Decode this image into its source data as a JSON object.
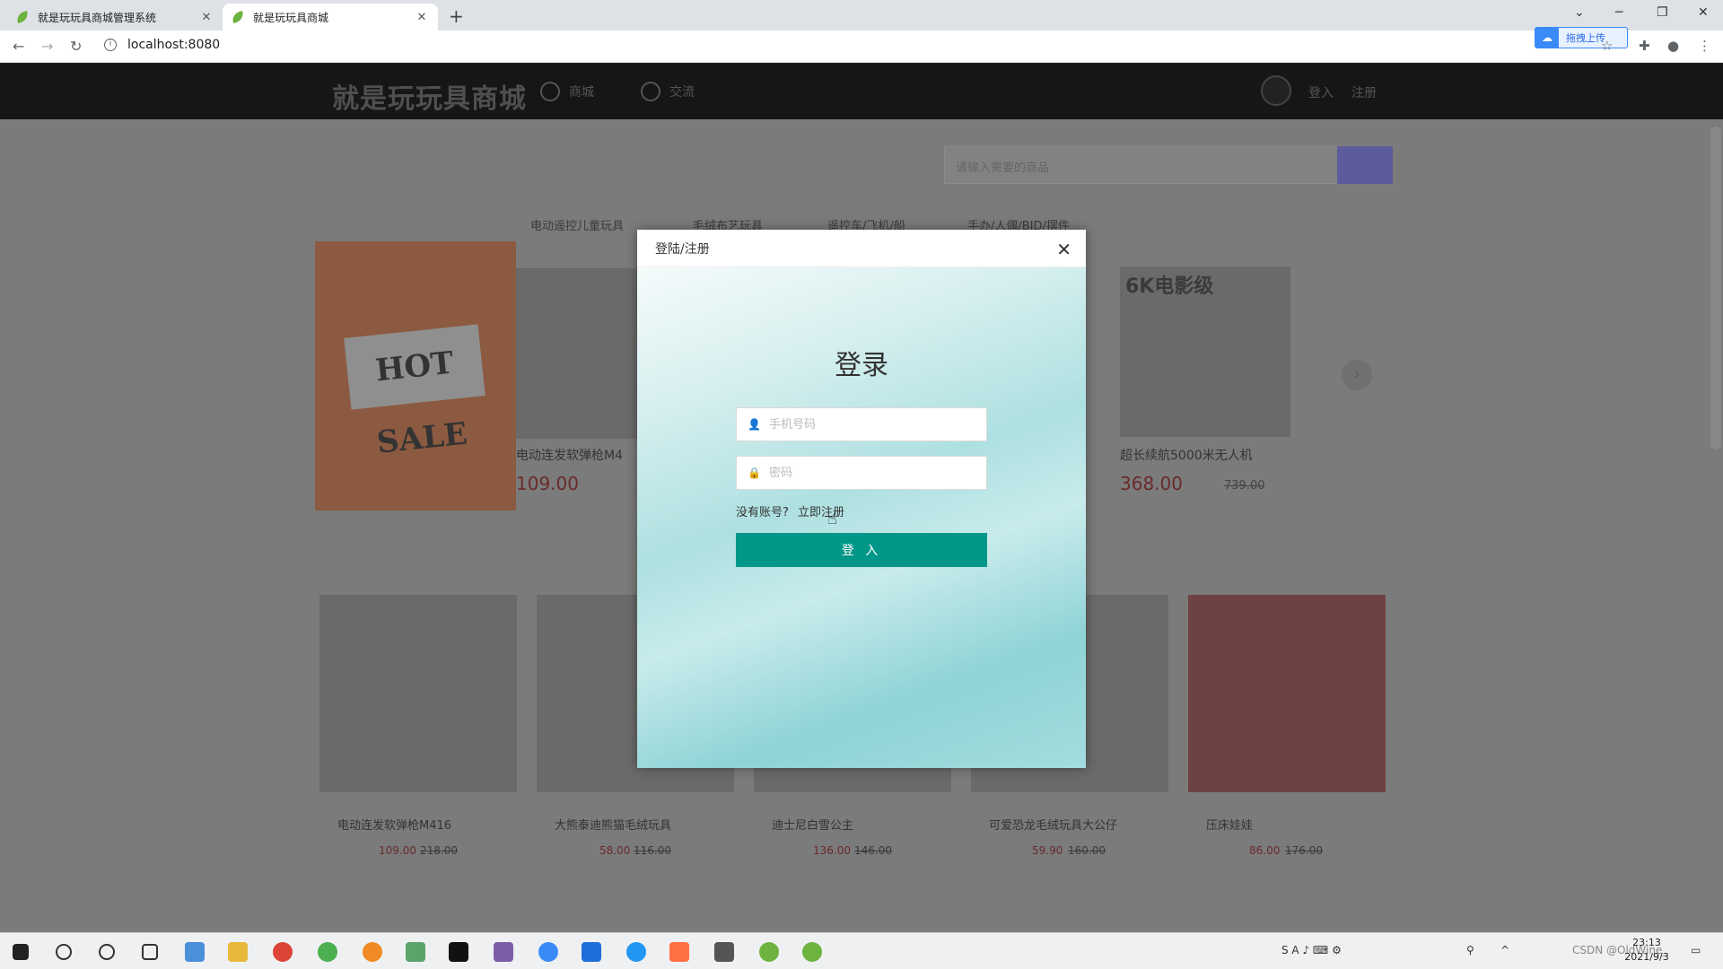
{
  "browser": {
    "tabs": [
      {
        "title": "就是玩玩具商城管理系统",
        "active": false
      },
      {
        "title": "就是玩玩具商城",
        "active": true
      }
    ],
    "url": "localhost:8080",
    "upload_label": "拖拽上传"
  },
  "site": {
    "logo": "就是玩玩具商城",
    "nav": [
      "商城",
      "交流"
    ],
    "login_link": "登入",
    "register_link": "注册",
    "search_placeholder": "请输入需要的商品",
    "categories": [
      "电动遥控儿童玩具",
      "毛绒布艺玩具",
      "遥控车/飞机/船",
      "手办/人偶/BJD/摆件"
    ],
    "hot_sale": "HOT SALE",
    "featured": [
      {
        "title": "电动连发软弹枪M4",
        "price": "109.00"
      },
      {
        "title": "超长续航5000米无人机",
        "price": "368.00",
        "old_price": "739.00"
      }
    ],
    "drone_banner": "6K电影级",
    "cards": [
      {
        "title": "电动连发软弹枪M416",
        "price": "109.00",
        "old_price": "218.00"
      },
      {
        "title": "大熊泰迪熊猫毛绒玩具",
        "price": "58.00",
        "old_price": "116.00"
      },
      {
        "title": "迪士尼白雪公主",
        "price": "136.00",
        "old_price": "146.00"
      },
      {
        "title": "可爱恐龙毛绒玩具大公仔",
        "price": "59.90",
        "old_price": "160.00"
      },
      {
        "title": "压床娃娃",
        "price": "86.00",
        "old_price": "176.00"
      }
    ]
  },
  "modal": {
    "header": "登陆/注册",
    "title": "登录",
    "phone_placeholder": "手机号码",
    "password_placeholder": "密码",
    "no_account": "没有账号?",
    "register_now": "立即注册",
    "login_button": "登 入"
  },
  "taskbar": {
    "time": "23:13",
    "date": "2021/9/3",
    "watermark": "CSDN @OldWine_"
  }
}
